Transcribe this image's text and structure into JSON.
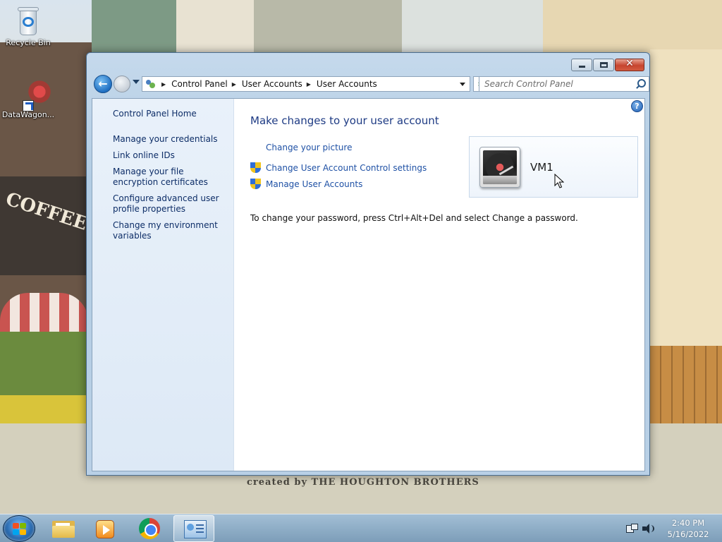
{
  "desktop": {
    "icons": [
      {
        "label": "Recycle Bin",
        "icon": "recycle-bin-icon"
      },
      {
        "label": "DataWagon...",
        "icon": "datawagon-shortcut-icon"
      }
    ],
    "wallpaper_text": "created by THE HOUGHTON BROTHERS"
  },
  "window": {
    "controls": {
      "minimize": "minimize",
      "maximize": "maximize",
      "close": "✕"
    },
    "address": {
      "crumbs": [
        "Control Panel",
        "User Accounts",
        "User Accounts"
      ]
    },
    "search": {
      "placeholder": "Search Control Panel"
    }
  },
  "sidebar": {
    "home": "Control Panel Home",
    "items": [
      {
        "label": "Manage your credentials"
      },
      {
        "label": "Link online IDs"
      },
      {
        "label": "Manage your file encryption certificates"
      },
      {
        "label": "Configure advanced user profile properties"
      },
      {
        "label": "Change my environment variables"
      }
    ]
  },
  "main": {
    "title": "Make changes to your user account",
    "tasks": [
      {
        "label": "Change your picture",
        "shield": false
      },
      {
        "label": "Change User Account Control settings",
        "shield": true
      },
      {
        "label": "Manage User Accounts",
        "shield": true
      }
    ],
    "password_note": "To change your password, press Ctrl+Alt+Del and select Change a password.",
    "help": "?"
  },
  "user": {
    "name": "VM1",
    "avatar": "turntable-picture"
  },
  "taskbar": {
    "apps": [
      "windows-explorer",
      "windows-media-player",
      "google-chrome",
      "control-panel"
    ],
    "active_app": "control-panel",
    "clock": {
      "time": "2:40 PM",
      "date": "5/16/2022"
    }
  }
}
